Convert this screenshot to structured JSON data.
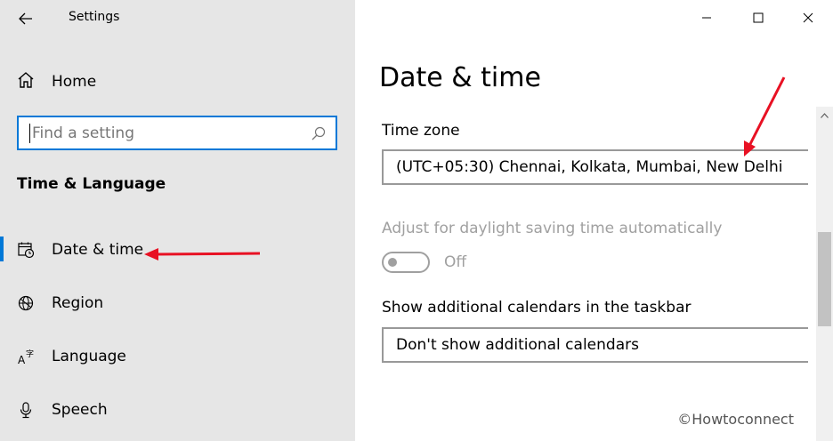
{
  "window": {
    "title": "Settings"
  },
  "sidebar": {
    "home_label": "Home",
    "search": {
      "placeholder": "Find a setting"
    },
    "section_heading": "Time & Language",
    "items": [
      {
        "label": "Date & time",
        "icon": "calendar-clock-icon",
        "active": true
      },
      {
        "label": "Region",
        "icon": "globe-icon",
        "active": false
      },
      {
        "label": "Language",
        "icon": "language-icon",
        "active": false
      },
      {
        "label": "Speech",
        "icon": "microphone-icon",
        "active": false
      }
    ]
  },
  "main": {
    "page_title": "Date & time",
    "time_zone": {
      "label": "Time zone",
      "value": "(UTC+05:30) Chennai, Kolkata, Mumbai, New Delhi"
    },
    "daylight": {
      "label": "Adjust for daylight saving time automatically",
      "state": "Off",
      "enabled": false
    },
    "calendars": {
      "label": "Show additional calendars in the taskbar",
      "value": "Don't show additional calendars"
    },
    "watermark": "©Howtoconnect"
  },
  "colors": {
    "accent": "#0078d7",
    "sidebar_bg": "#e6e6e6",
    "annotation": "#e81123",
    "disabled": "#a0a0a0"
  }
}
